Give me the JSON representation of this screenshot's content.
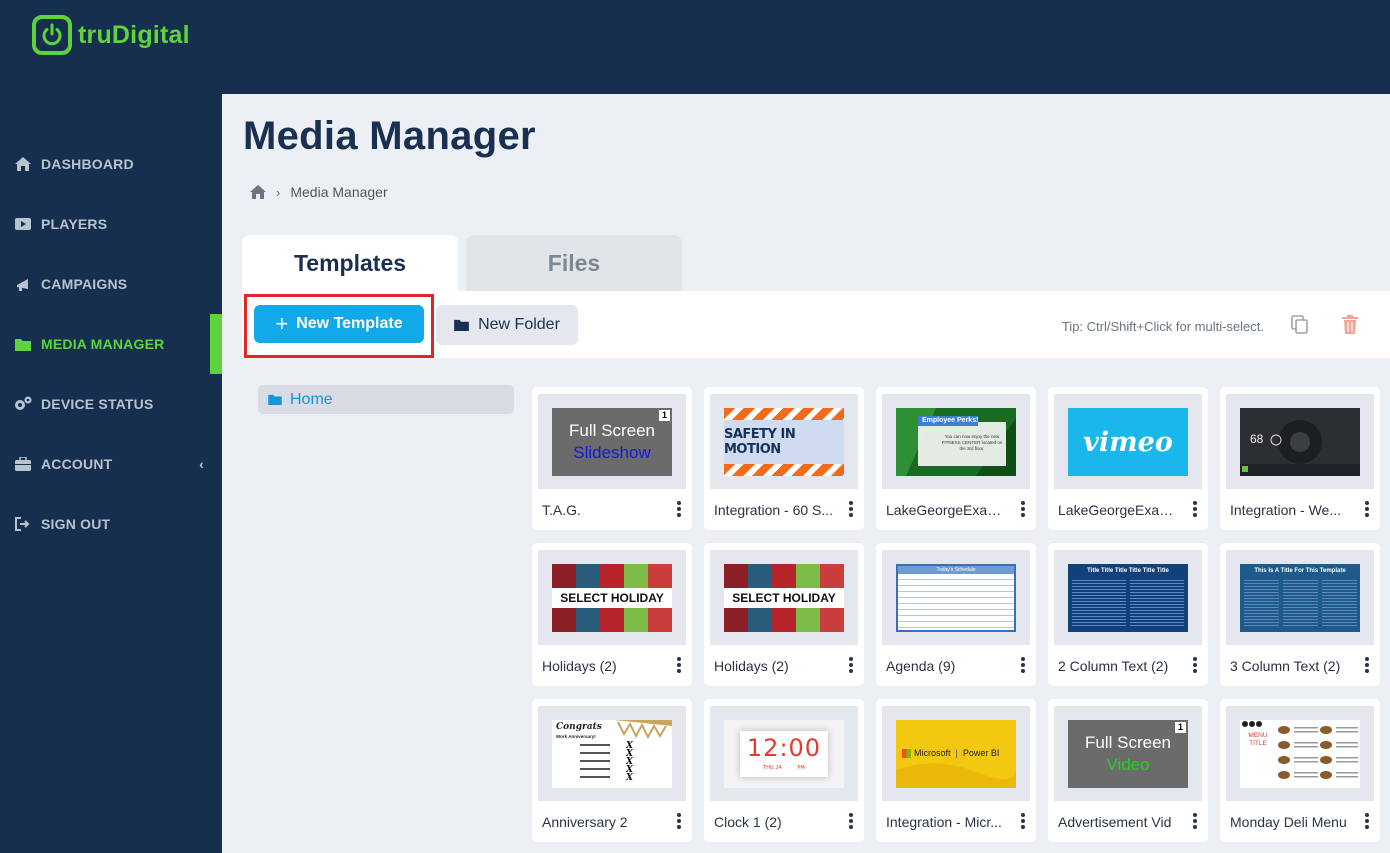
{
  "brand": {
    "name": "truDigital",
    "accent": "#5ed33a",
    "bg": "#162f4f"
  },
  "sidebar": {
    "items": [
      {
        "label": "DASHBOARD",
        "icon": "home-icon"
      },
      {
        "label": "PLAYERS",
        "icon": "play-icon"
      },
      {
        "label": "CAMPAIGNS",
        "icon": "megaphone-icon"
      },
      {
        "label": "MEDIA MANAGER",
        "icon": "folder-icon",
        "active": true
      },
      {
        "label": "DEVICE STATUS",
        "icon": "cogs-icon"
      },
      {
        "label": "ACCOUNT",
        "icon": "briefcase-icon"
      },
      {
        "label": "SIGN OUT",
        "icon": "sign-out-icon"
      }
    ]
  },
  "page": {
    "title": "Media Manager",
    "breadcrumb": {
      "current": "Media Manager"
    }
  },
  "tabs": {
    "templates": "Templates",
    "files": "Files"
  },
  "toolbar": {
    "new_template": "New Template",
    "new_folder": "New Folder",
    "tip": "Tip: Ctrl/Shift+Click for multi-select."
  },
  "folders": {
    "home": "Home"
  },
  "thumb_text": {
    "full_screen": "Full Screen",
    "slideshow": "Slideshow",
    "video": "Video",
    "badge": "1",
    "safety": "SAFETY IN MOTION",
    "perks": "Employee Perks!",
    "perks_body": "You can now enjoy the new FITNESS CENTER located on the 3rd floor.",
    "vimeo": "vimeo",
    "weather_temp": "68",
    "select_holiday": "SELECT HOLIDAY",
    "agenda_head": "Today's Schedule",
    "two_col_head": "Title Title Title Title Title Title",
    "three_col_head": "This Is A Title For This Template",
    "congrats": "Congrats",
    "work_anniv": "Work Anniversary!",
    "clock_time": "12:00",
    "clock_day": "THU 24",
    "clock_pm": "PM",
    "microsoft": "Microsoft",
    "power_bi": "Power BI",
    "menu_title": "MENU TITLE"
  },
  "templates": [
    {
      "title": "T.A.G.",
      "thumb": "fs-slideshow"
    },
    {
      "title": "Integration - 60 S...",
      "thumb": "safety"
    },
    {
      "title": "LakeGeorgeExam...",
      "thumb": "perks"
    },
    {
      "title": "LakeGeorgeExam...",
      "thumb": "vimeo"
    },
    {
      "title": "Integration - We...",
      "thumb": "weather"
    },
    {
      "title": "Holidays (2)",
      "thumb": "holiday"
    },
    {
      "title": "Holidays (2)",
      "thumb": "holiday"
    },
    {
      "title": "Agenda (9)",
      "thumb": "agenda"
    },
    {
      "title": "2 Column Text (2)",
      "thumb": "twocol"
    },
    {
      "title": "3 Column Text (2)",
      "thumb": "threecol"
    },
    {
      "title": "Anniversary 2",
      "thumb": "anniv"
    },
    {
      "title": "Clock 1 (2)",
      "thumb": "clock"
    },
    {
      "title": "Integration - Micr...",
      "thumb": "pbi"
    },
    {
      "title": "Advertisement Vid",
      "thumb": "fs-video"
    },
    {
      "title": "Monday Deli Menu",
      "thumb": "deli"
    }
  ]
}
